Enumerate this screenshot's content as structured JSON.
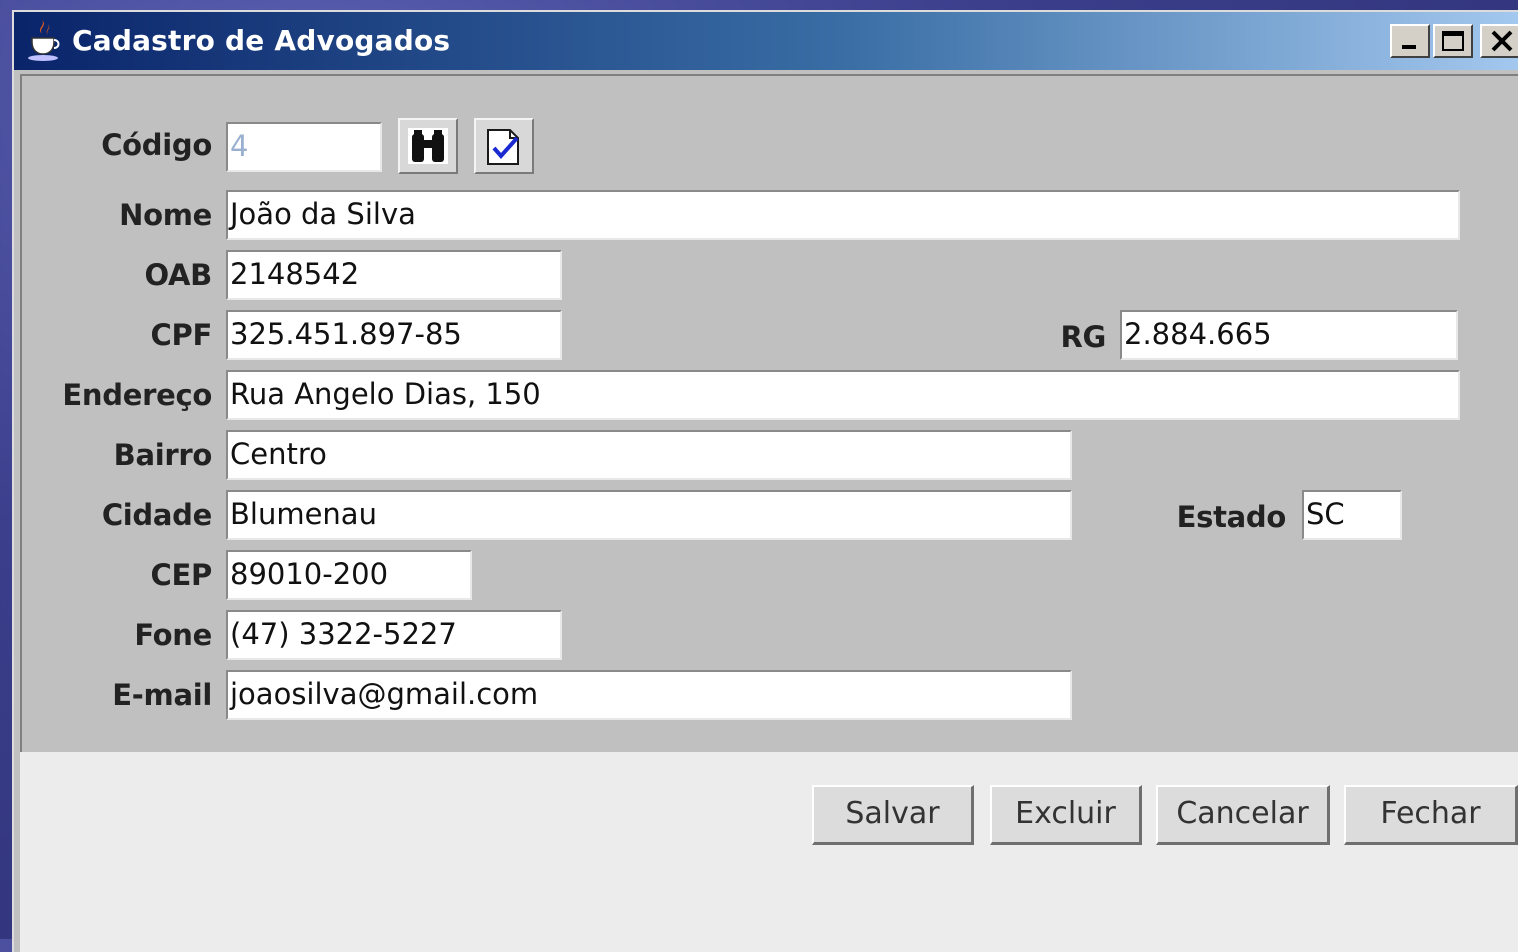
{
  "window": {
    "title": "Cadastro de Advogados",
    "app_icon": "java-cup-icon",
    "controls": [
      "minimize-icon",
      "maximize-icon",
      "close-icon"
    ]
  },
  "form": {
    "codigo": {
      "label": "Código",
      "value": "4"
    },
    "search_button_icon": "binoculars-icon",
    "confirm_button_icon": "document-check-icon",
    "nome": {
      "label": "Nome",
      "value": "João da Silva"
    },
    "oab": {
      "label": "OAB",
      "value": "2148542"
    },
    "cpf": {
      "label": "CPF",
      "value": "325.451.897-85"
    },
    "rg": {
      "label": "RG",
      "value": "2.884.665"
    },
    "endereco": {
      "label": "Endereço",
      "value": "Rua Angelo Dias, 150"
    },
    "bairro": {
      "label": "Bairro",
      "value": "Centro"
    },
    "cidade": {
      "label": "Cidade",
      "value": "Blumenau"
    },
    "estado": {
      "label": "Estado",
      "value": "SC"
    },
    "cep": {
      "label": "CEP",
      "value": "89010-200"
    },
    "fone": {
      "label": "Fone",
      "value": "(47) 3322-5227"
    },
    "email": {
      "label": "E-mail",
      "value": "joaosilva@gmail.com"
    }
  },
  "actions": {
    "salvar": "Salvar",
    "excluir": "Excluir",
    "cancelar": "Cancelar",
    "fechar": "Fechar"
  }
}
